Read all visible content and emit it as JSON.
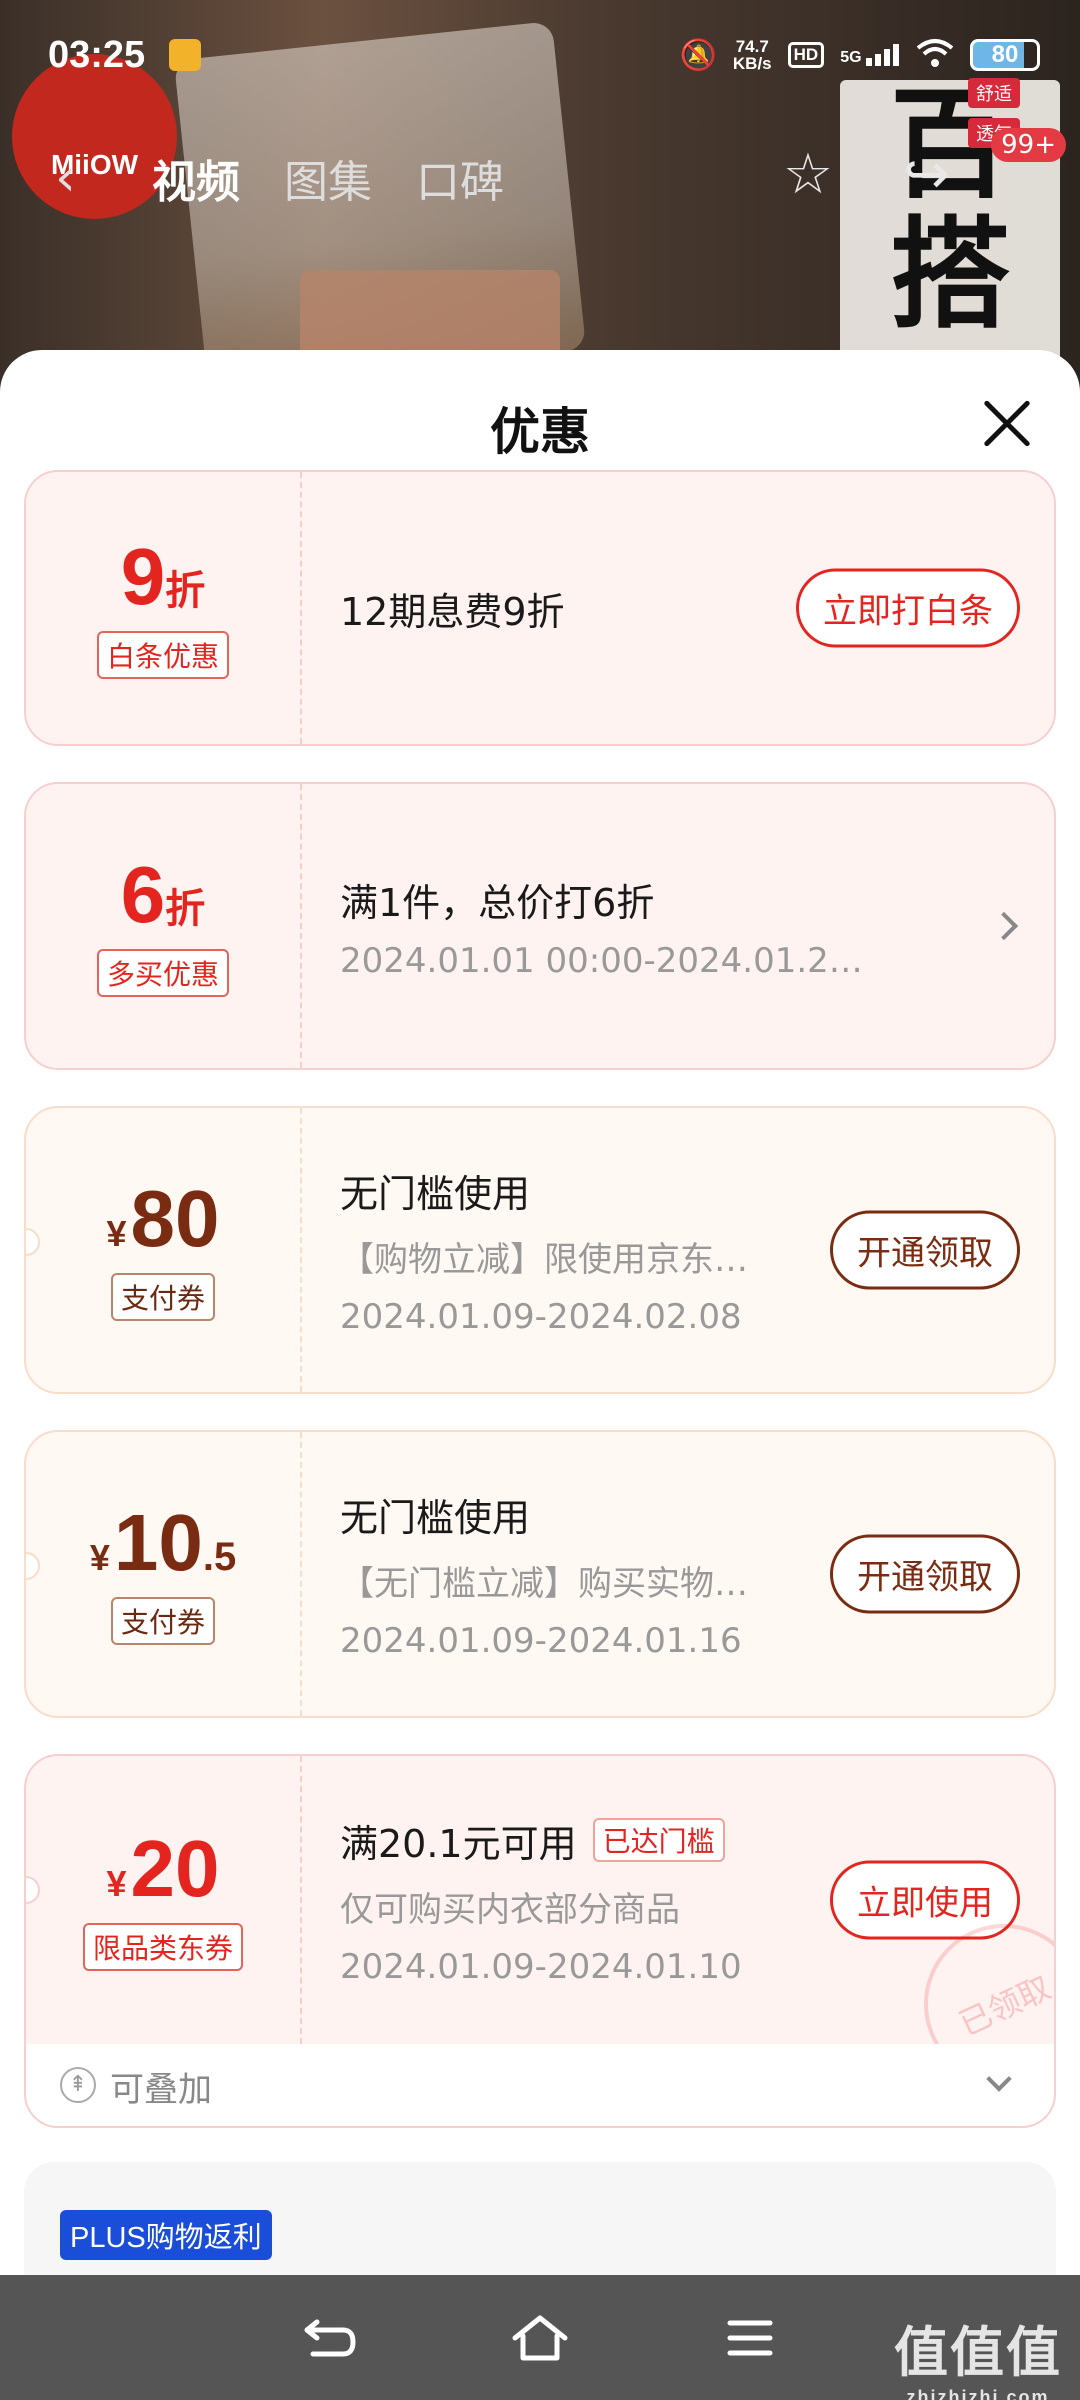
{
  "status_bar": {
    "time": "03:25",
    "net_speed_value": "74.7",
    "net_speed_unit": "KB/s",
    "hd": "HD",
    "signal": "5G",
    "battery": "80",
    "icons": [
      "mute-bell-icon",
      "wifi-icon",
      "signal-icon",
      "battery-icon"
    ]
  },
  "background": {
    "logo": "MiiOW",
    "poster_main": "百搭",
    "poster_tags": [
      "舒适",
      "透气"
    ],
    "cart_badge": "99+"
  },
  "product_nav": {
    "tabs": [
      {
        "label": "视频",
        "active": true
      },
      {
        "label": "图集",
        "active": false
      },
      {
        "label": "口碑",
        "active": false
      }
    ]
  },
  "sheet": {
    "title": "优惠"
  },
  "offers": [
    {
      "value": "9",
      "unit": "折",
      "tag": "白条优惠",
      "line1": "12期息费9折",
      "action": "立即打白条"
    },
    {
      "value": "6",
      "unit": "折",
      "tag": "多买优惠",
      "line1": "满1件，总价打6折",
      "line2": "2024.01.01 00:00-2024.01.2…"
    },
    {
      "currency": "¥",
      "value": "80",
      "tag": "支付券",
      "line1": "无门槛使用",
      "line2": "【购物立减】限使用京东…",
      "line3": "2024.01.09-2024.02.08",
      "action": "开通领取"
    },
    {
      "currency": "¥",
      "value": "10",
      "decimal": ".5",
      "tag": "支付券",
      "line1": "无门槛使用",
      "line2": "【无门槛立减】购买实物…",
      "line3": "2024.01.09-2024.01.16",
      "action": "开通领取"
    },
    {
      "currency": "¥",
      "value": "20",
      "tag": "限品类东券",
      "line1": "满20.1元可用",
      "reached": "已达门槛",
      "line2": "仅可购买内衣部分商品",
      "line3": "2024.01.09-2024.01.10",
      "action": "立即使用",
      "stamp": "已领取"
    }
  ],
  "stackable": {
    "label": "可叠加"
  },
  "plus": {
    "badge": "PLUS购物返利"
  },
  "watermark": {
    "main": "值值值",
    "site": "zhizhizhi.com"
  },
  "colors": {
    "accent_red": "#e4251f",
    "coupon_brown": "#7a2c12",
    "plus_blue": "#1b4ed8"
  }
}
